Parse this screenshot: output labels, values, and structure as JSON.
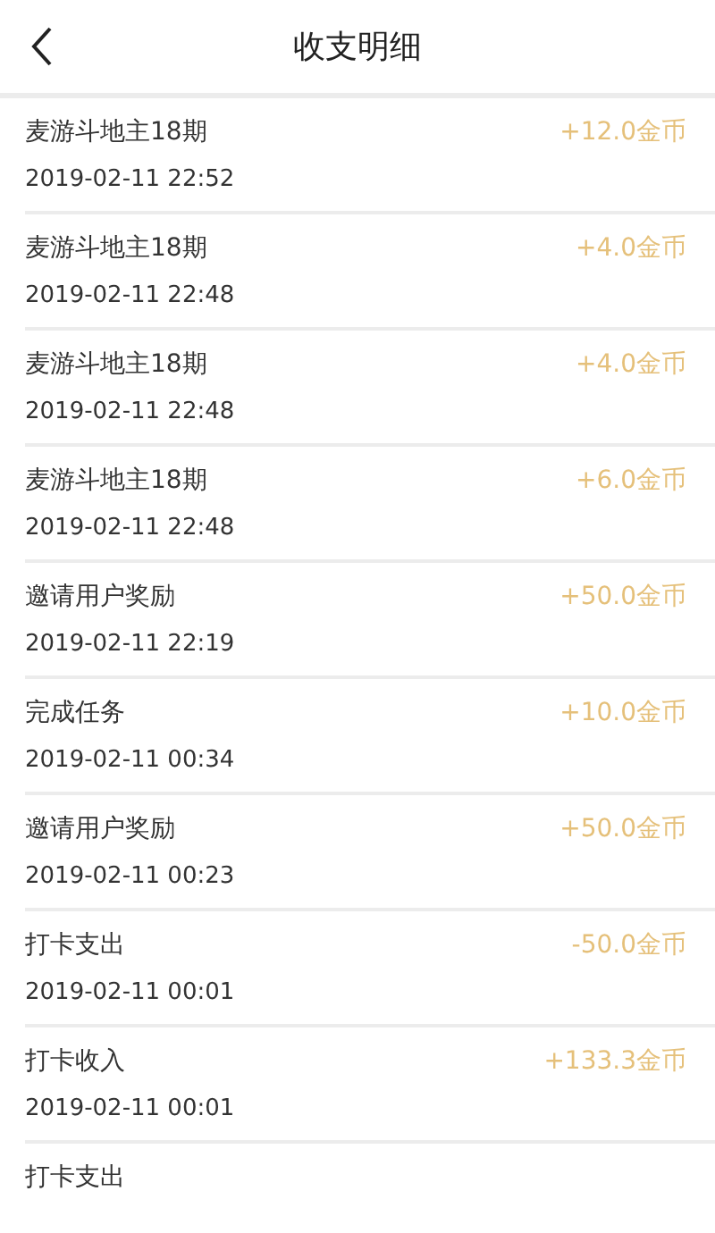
{
  "header": {
    "title": "收支明细"
  },
  "records": [
    {
      "title": "麦游斗地主18期",
      "time": "2019-02-11 22:52",
      "amount": "+12.0金币"
    },
    {
      "title": "麦游斗地主18期",
      "time": "2019-02-11 22:48",
      "amount": "+4.0金币"
    },
    {
      "title": "麦游斗地主18期",
      "time": "2019-02-11 22:48",
      "amount": "+4.0金币"
    },
    {
      "title": "麦游斗地主18期",
      "time": "2019-02-11 22:48",
      "amount": "+6.0金币"
    },
    {
      "title": "邀请用户奖励",
      "time": "2019-02-11 22:19",
      "amount": "+50.0金币"
    },
    {
      "title": "完成任务",
      "time": "2019-02-11 00:34",
      "amount": "+10.0金币"
    },
    {
      "title": "邀请用户奖励",
      "time": "2019-02-11 00:23",
      "amount": "+50.0金币"
    },
    {
      "title": "打卡支出",
      "time": "2019-02-11 00:01",
      "amount": "-50.0金币"
    },
    {
      "title": "打卡收入",
      "time": "2019-02-11 00:01",
      "amount": "+133.3金币"
    },
    {
      "title": "打卡支出"
    }
  ]
}
